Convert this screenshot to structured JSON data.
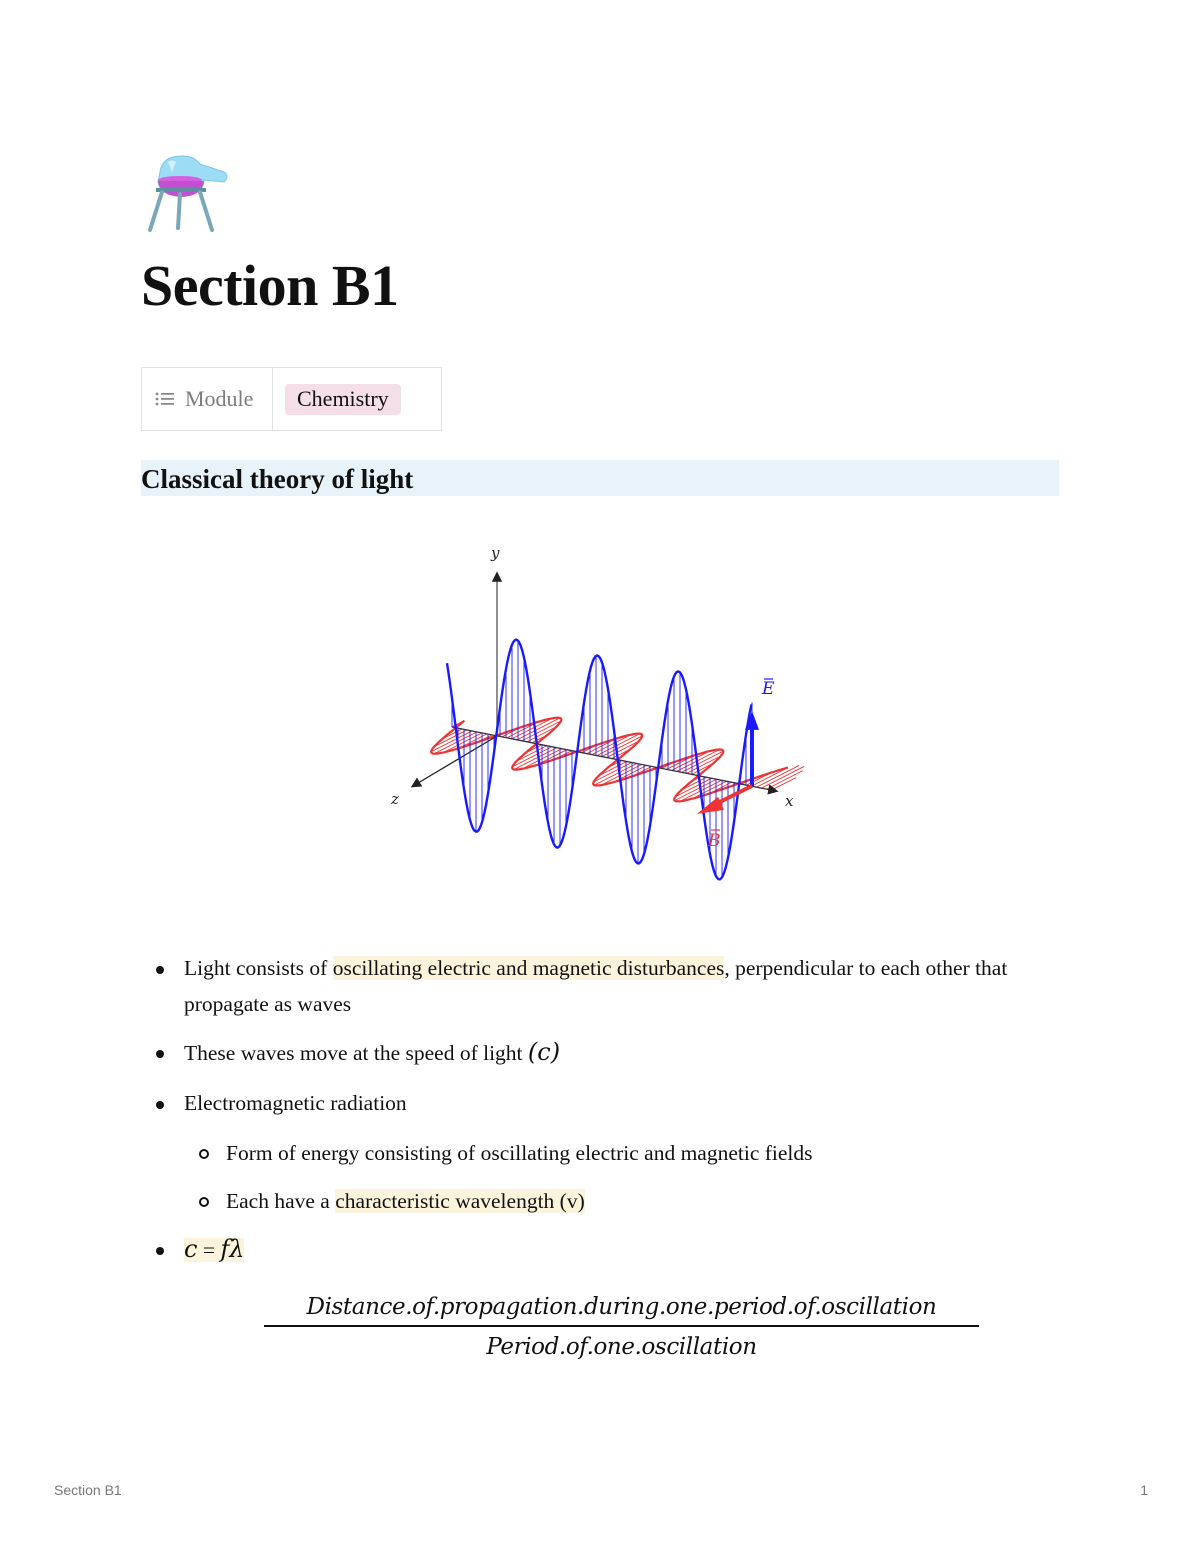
{
  "page": {
    "icon": "alembic-flask-icon",
    "title": "Section B1"
  },
  "properties": [
    {
      "icon": "list-icon",
      "key": "Module",
      "value": "Chemistry",
      "value_color": "#f4dfe8"
    }
  ],
  "section": {
    "heading": "Classical theory of light",
    "heading_bg": "#e7f3f8"
  },
  "diagram": {
    "axis_labels": {
      "y": "y",
      "z": "z",
      "x": "x"
    },
    "vector_labels": {
      "e": "E",
      "b": "B"
    },
    "colors": {
      "electric": "#1a1aff",
      "magnetic": "#ee3333",
      "axis": "#222222"
    }
  },
  "bullets": [
    {
      "pre": "Light consists of ",
      "highlight": "oscillating electric and magnetic disturbances",
      "post": ", perpendicular to each other that propagate as waves"
    },
    {
      "pre": "These waves move at the speed of light ",
      "math": "(c)"
    },
    {
      "text": "Electromagnetic radiation",
      "children": [
        {
          "text": "Form of energy consisting of oscillating electric and magnetic fields"
        },
        {
          "pre": "Each have a ",
          "highlight": "characteristic wavelength (v)"
        }
      ]
    },
    {
      "math_highlight_c": "c",
      "math_highlight_eq": " = ",
      "math_highlight_rhs": "fλ"
    }
  ],
  "fraction": {
    "numerator": "Distance.of.propagation.during.one.period.of.oscillation",
    "denominator": "Period.of.one.oscillation"
  },
  "highlight_color": "#fbf3db",
  "footer": {
    "left": "Section B1",
    "right": "1"
  }
}
